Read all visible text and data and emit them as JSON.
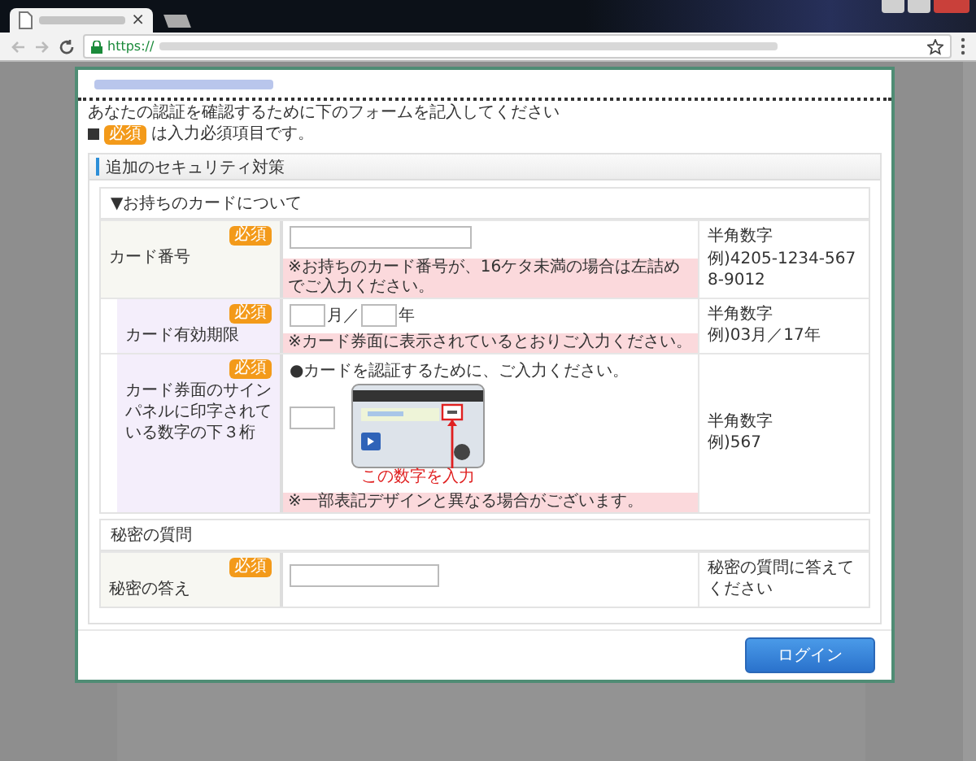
{
  "browser": {
    "tab_close": "×",
    "url_scheme": "https://"
  },
  "modal": {
    "intro": "あなたの認証を確認するために下のフォームを記入してください",
    "required_note": "は入力必須項目です。",
    "required_badge": "必須",
    "section_title": "追加のセキュリティ対策",
    "groups": [
      {
        "heading": "▼お持ちのカードについて",
        "rows": [
          {
            "kind": "number",
            "label": "カード番号",
            "badge": "必須",
            "note": "※お持ちのカード番号が、16ケタ未満の場合は左詰めでご入力ください。",
            "hints": [
              "半角数字",
              "例)4205-1234-5678-9012"
            ]
          },
          {
            "kind": "expiry",
            "label": "カード有効期限",
            "badge": "必須",
            "month_unit": "月／",
            "year_unit": "年",
            "note": "※カード券面に表示されているとおりご入力ください。",
            "hints": [
              "半角数字",
              "例)03月／17年"
            ]
          },
          {
            "kind": "code",
            "label": "カード券面のサインパネルに印字されている数字の下３桁",
            "badge": "必須",
            "instruction": "●カードを認証するために、ご入力ください。",
            "caption": "この数字を入力",
            "note": "※一部表記デザインと異なる場合がございます。",
            "hints": [
              "半角数字",
              "例)567"
            ]
          }
        ]
      },
      {
        "heading": "秘密の質問",
        "rows": [
          {
            "kind": "answer",
            "label": "秘密の答え",
            "badge": "必須",
            "hints": [
              "秘密の質問に答えてください"
            ]
          }
        ]
      }
    ],
    "button": "ログイン"
  }
}
